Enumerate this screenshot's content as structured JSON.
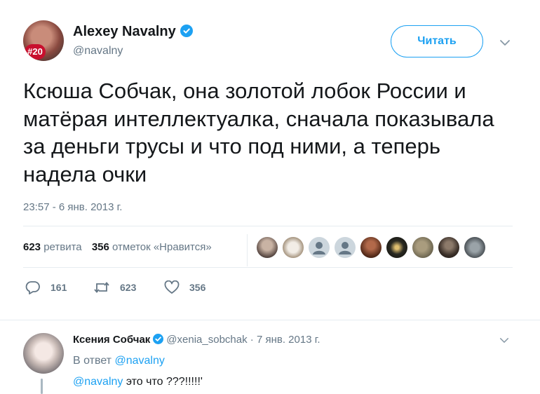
{
  "tweet": {
    "author_name": "Alexey Navalny",
    "author_handle": "@navalny",
    "avatar_badge": "#20",
    "follow_label": "Читать",
    "text": "Ксюша Собчак, она золотой лобок России и матёрая интеллектуалка, сначала показывала за деньги трусы и что под ними, а теперь надела очки",
    "timestamp": "23:57 - 6 янв. 2013 г.",
    "retweets_count": "623",
    "retweets_label": "ретвита",
    "likes_count": "356",
    "likes_label": "отметок «Нравится»",
    "actions": {
      "replies": "161",
      "retweets": "623",
      "likes": "356"
    }
  },
  "reply": {
    "author_name": "Ксения Собчак",
    "author_handle": "@xenia_sobchak",
    "separator": "·",
    "date": "7 янв. 2013 г.",
    "reply_to_prefix": "В ответ",
    "reply_to_handle": "@navalny",
    "text_mention": "@navalny",
    "text": " это что ???!!!!!'"
  },
  "colors": {
    "accent": "#1da1f2",
    "muted": "#657786",
    "text": "#14171a",
    "border": "#e6ecf0"
  },
  "icons": [
    "verified-icon",
    "chevron-down-icon",
    "reply-icon",
    "retweet-icon",
    "like-icon",
    "default-avatar-icon"
  ]
}
